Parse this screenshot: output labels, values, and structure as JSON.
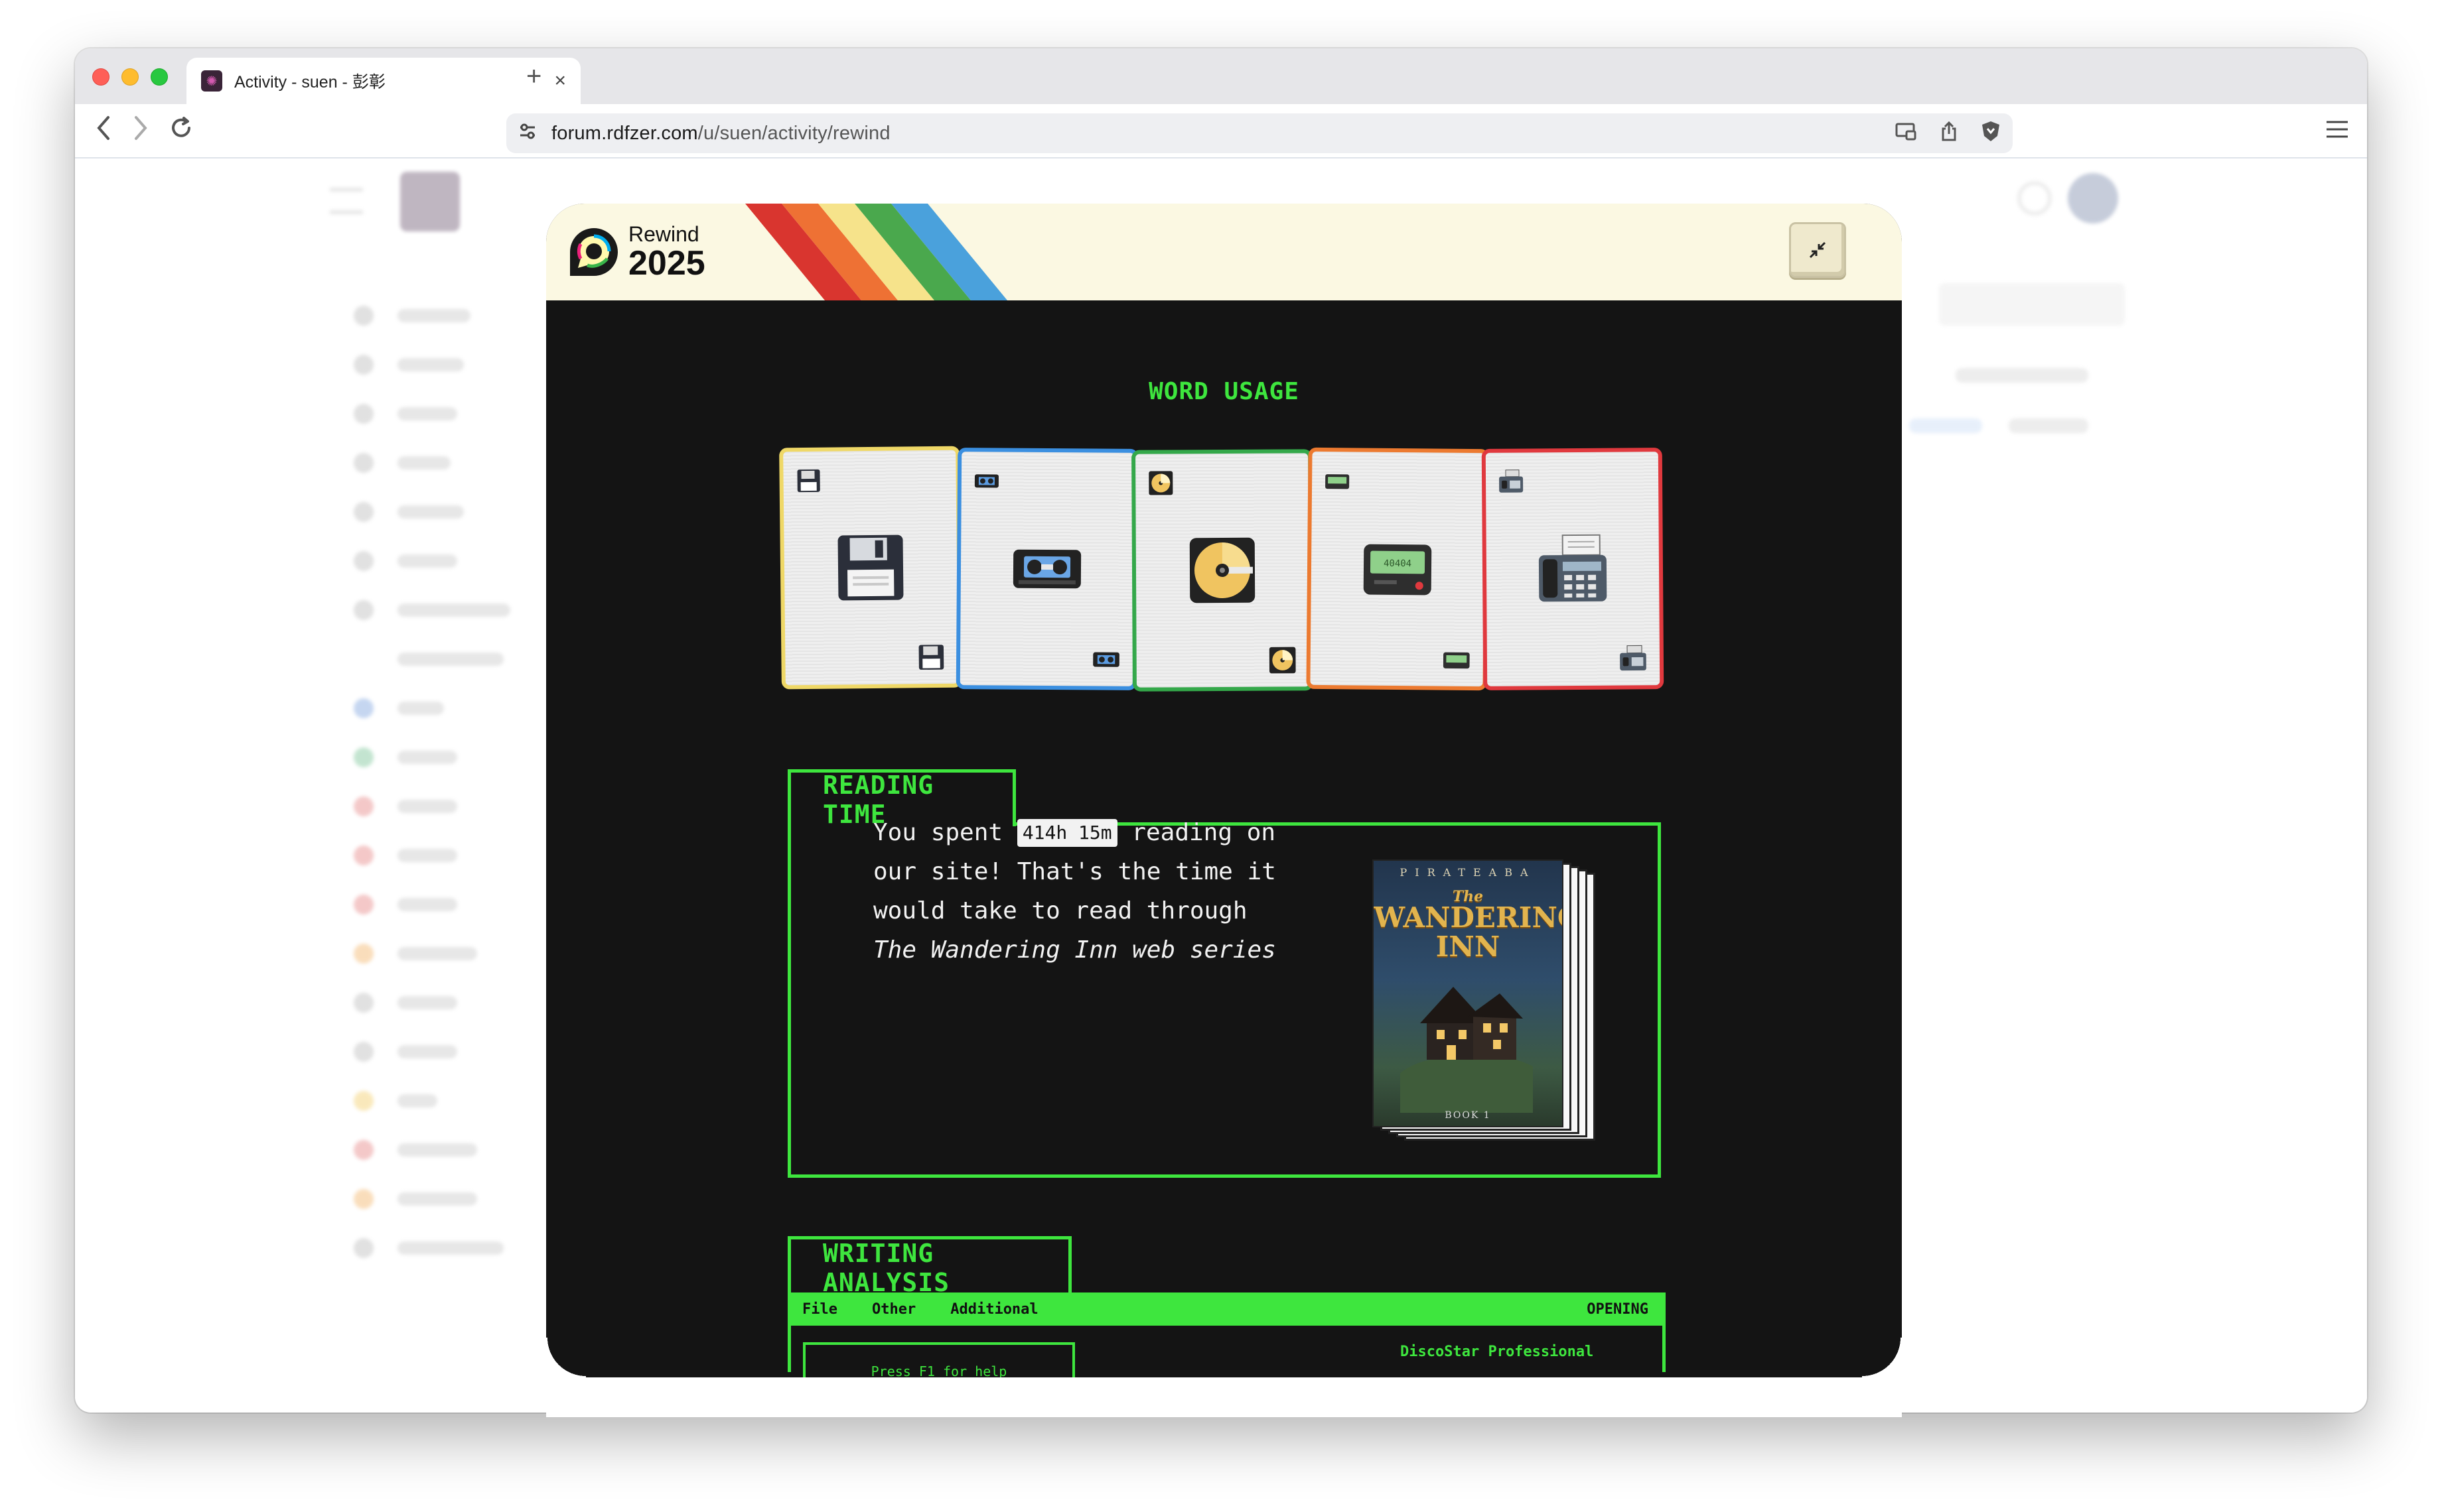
{
  "browser": {
    "tab_title": "Activity - suen - 彭彰",
    "tab_close": "×",
    "new_tab": "+",
    "url_host": "forum.rdfzer.com",
    "url_path": "/u/suen/activity/rewind",
    "icons": [
      "back-icon",
      "forward-icon",
      "reload-icon",
      "site-settings-icon",
      "cast-icon",
      "share-icon",
      "brave-shield-icon",
      "menu-icon"
    ]
  },
  "rewind": {
    "logo_word": "Rewind",
    "logo_year": "2025",
    "stripe_colors": [
      "#d9352f",
      "#ee7134",
      "#f6e38b",
      "#4aa84d",
      "#4aa1dc"
    ],
    "word_usage_title": "WORD USAGE",
    "cards": [
      {
        "icon": "floppy-disk-icon",
        "border": "#efd867"
      },
      {
        "icon": "vhs-tape-icon",
        "border": "#3b8fe0"
      },
      {
        "icon": "cd-icon",
        "border": "#34a84a"
      },
      {
        "icon": "pager-icon",
        "border": "#ec7a30"
      },
      {
        "icon": "fax-machine-icon",
        "border": "#e0393e"
      }
    ],
    "pager_text": "40404",
    "reading_time": {
      "title": "READING TIME",
      "prefix": "You spent",
      "time": "414h 15m",
      "middle": "reading on our site! That's the time it would take to read through",
      "book": "The Wandering Inn web series"
    },
    "book_cover": {
      "author": "PIRATEABA",
      "title_small": "The",
      "title_line1": "WANDERING",
      "title_line2": "INN",
      "volume": "BOOK 1"
    },
    "writing_analysis": {
      "title": "WRITING ANALYSIS",
      "menu": [
        "File",
        "Other",
        "Additional"
      ],
      "status": "OPENING",
      "help": "Press F1 for help",
      "product": "DiscoStar Professional"
    }
  }
}
